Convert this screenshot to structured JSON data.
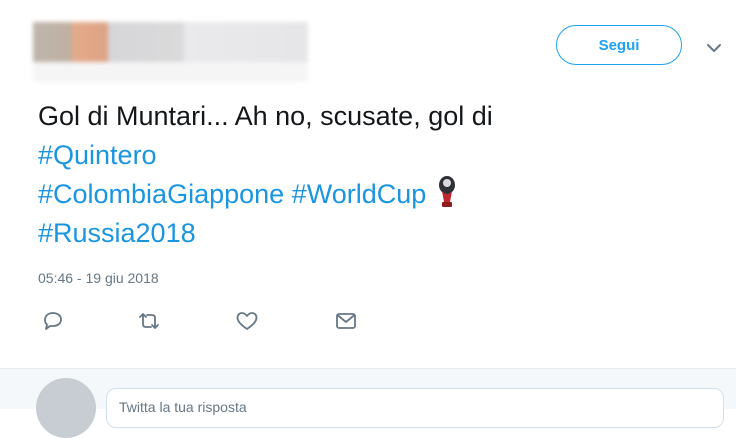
{
  "header": {
    "follow_label": "Segui"
  },
  "tweet": {
    "text_plain": "Gol di Muntari... Ah no, scusate, gol di",
    "hashtags": [
      "#Quintero",
      "#ColombiaGiappone",
      "#WorldCup",
      "#Russia2018"
    ],
    "emoji_icon": "world-cup-trophy-icon",
    "timestamp": "05:46 - 19 giu 2018"
  },
  "actions": [
    {
      "icon": "reply-icon"
    },
    {
      "icon": "retweet-icon"
    },
    {
      "icon": "like-icon"
    },
    {
      "icon": "direct-message-icon"
    }
  ],
  "reply": {
    "placeholder": "Twitta la tua risposta"
  },
  "colors": {
    "accent": "#1da1f2",
    "hashtag": "#1b95e0",
    "text": "#14171a",
    "muted": "#657786"
  }
}
